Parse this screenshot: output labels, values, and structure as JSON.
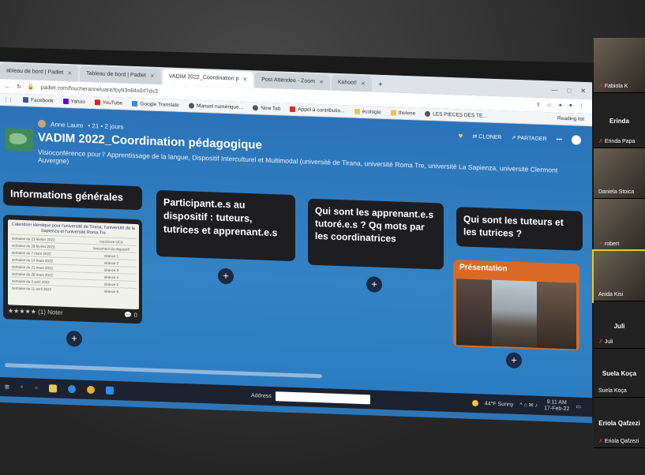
{
  "browser": {
    "tabs": [
      {
        "label": "ableau de bord | Padlet",
        "active": false
      },
      {
        "label": "Tableau de bord | Padlet",
        "active": false
      },
      {
        "label": "VADIM 2022_Coordination p",
        "active": true
      },
      {
        "label": "Post Attendee - Zoom",
        "active": false
      },
      {
        "label": "Kahoot!",
        "active": false
      }
    ],
    "url": "padlet.com/foucheranneluare/fpy93n84x0rf7dx3",
    "bookmarks": [
      "Facebook",
      "Yahoo",
      "YouTube",
      "Google Translate",
      "Manuel numérique...",
      "New Tab",
      "Appel à contributio...",
      "écologie",
      "thelene",
      "LES PIECES DES TE...",
      "Reading list"
    ]
  },
  "padlet": {
    "owner": "Anne Laure",
    "stats": "• 21 • 2 jours",
    "title": "VADIM 2022_Coordination pédagogique",
    "description": "Visioconférence pour l' Apprentissage de la langue, Dispositif Interculturel et Multimodal (université de Tirana, université Roma Tre, université La Sapienza, université Clermont Auvergne)",
    "clone_label": "CLONER",
    "share_label": "PARTAGER",
    "columns": [
      "Informations générales",
      "Participant.e.s au dispositif : tuteurs, tutrices et apprenant.e.s",
      "Qui sont les apprenant.e.s tutoré.e.s ? Qq mots par les coordinatrices",
      "Qui sont les tuteurs et les tutrices ?"
    ],
    "calendar": {
      "title": "Calendrier identique pour l'université de Tirana, l'université de la Sapienza et l'université Roma Tre",
      "rows": [
        {
          "date": "semaine du 21 février 2022",
          "event": "vacances UCA"
        },
        {
          "date": "semaine du 28 février 2022",
          "event": "lancement du dispositif"
        },
        {
          "date": "semaine du 7 mars 2022",
          "event": "séance 1"
        },
        {
          "date": "semaine du 14 mars 2022",
          "event": "séance 2"
        },
        {
          "date": "semaine du 21 mars 2022",
          "event": "séance 3"
        },
        {
          "date": "semaine du 28 mars 2022",
          "event": "séance 4"
        },
        {
          "date": "semaine du 4 avril 2022",
          "event": "séance 5"
        },
        {
          "date": "semaine du 11 avril 2022",
          "event": "séance 6"
        }
      ],
      "rating_label": "★★★★★ (1) Noter",
      "comments": "0"
    },
    "presentation_label": "Présentation"
  },
  "taskbar": {
    "address_label": "Address",
    "weather": "44°F Sunny",
    "time": "9:11 AM",
    "date": "17-Feb-22"
  },
  "zoom": {
    "participants": [
      {
        "name": "Fabiola K",
        "video": true
      },
      {
        "name": "Erinda",
        "video": false,
        "sub": "Erinda Papa"
      },
      {
        "name": "Daniela Stoica",
        "video": true
      },
      {
        "name": "robert",
        "video": true
      },
      {
        "name": "Anida Kisi",
        "video": true
      },
      {
        "name": "Juli",
        "video": false,
        "sub": "Juli"
      },
      {
        "name": "Suela Koça",
        "video": false,
        "sub": "Suela Koça"
      },
      {
        "name": "Eriola Qafzezi",
        "video": false,
        "sub": "Eriola Qafzezi"
      }
    ]
  }
}
